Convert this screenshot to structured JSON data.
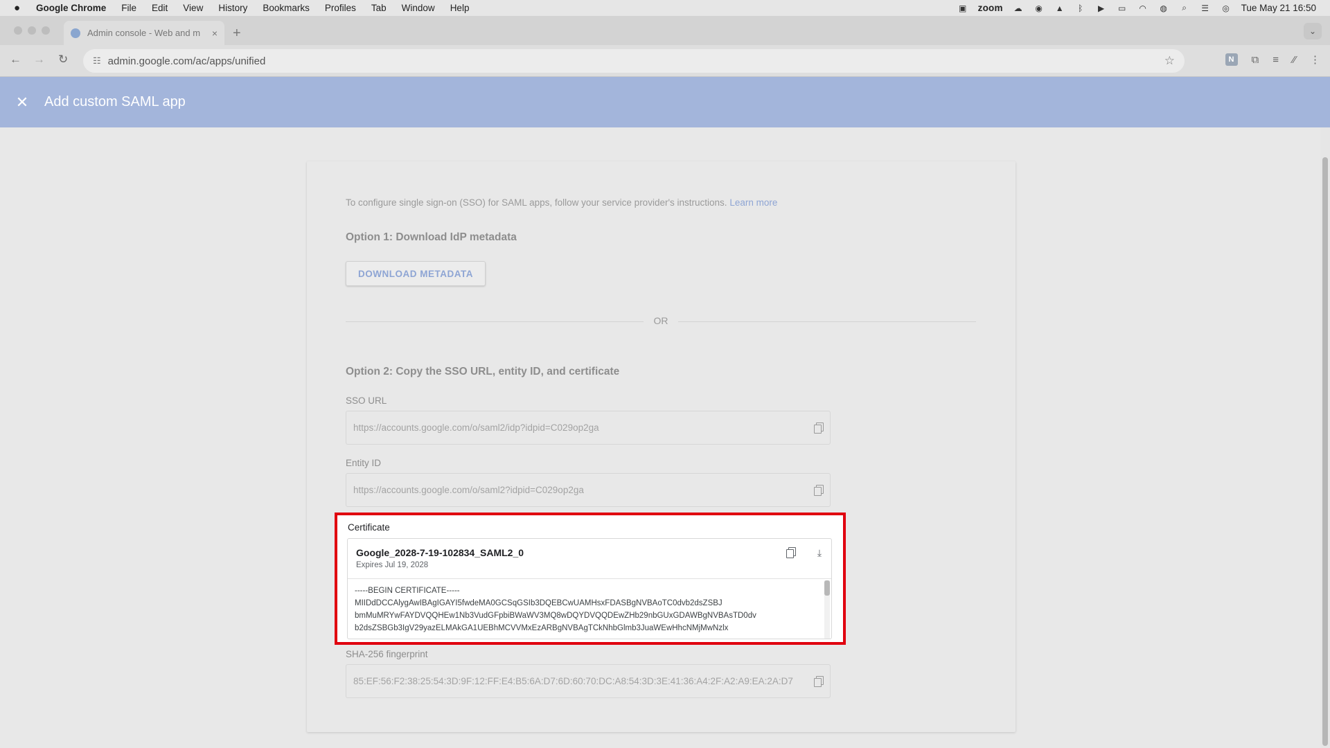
{
  "menubar": {
    "apple": "",
    "app_name": "Google Chrome",
    "items": [
      "File",
      "Edit",
      "View",
      "History",
      "Bookmarks",
      "Profiles",
      "Tab",
      "Window",
      "Help"
    ],
    "zoom": "zoom",
    "datetime": "Tue May 21  16:50"
  },
  "browser": {
    "tab_title": "Admin console - Web and m",
    "tab_close": "×",
    "new_tab": "+",
    "tab_menu": "⌄",
    "url": "admin.google.com/ac/apps/unified",
    "ext_badge": "N"
  },
  "header": {
    "close": "✕",
    "title": "Add custom SAML app"
  },
  "page": {
    "intro_text": "To configure single sign-on (SSO) for SAML apps, follow your service provider's instructions.",
    "learn_more": "Learn more",
    "option1_title": "Option 1: Download IdP metadata",
    "download_button": "DOWNLOAD METADATA",
    "or_text": "OR",
    "option2_title": "Option 2: Copy the SSO URL, entity ID, and certificate",
    "sso_url_label": "SSO URL",
    "sso_url_value": "https://accounts.google.com/o/saml2/idp?idpid=C029op2ga",
    "entity_id_label": "Entity ID",
    "entity_id_value": "https://accounts.google.com/o/saml2?idpid=C029op2ga",
    "certificate_label": "Certificate",
    "certificate_name": "Google_2028-7-19-102834_SAML2_0",
    "certificate_expires": "Expires Jul 19, 2028",
    "certificate_lines": [
      "-----BEGIN CERTIFICATE-----",
      "MIIDdDCCAlygAwIBAgIGAYI5fwdeMA0GCSqGSIb3DQEBCwUAMHsxFDASBgNVBAoTC0dvb2dsZSBJ",
      "bmMuMRYwFAYDVQQHEw1Nb3VudGFpbiBWaWV3MQ8wDQYDVQQDEwZHb29nbGUxGDAWBgNVBAsTD0dv",
      "b2dsZSBGb3IgV29yazELMAkGA1UEBhMCVVMxEzARBgNVBAgTCkNhbGlmb3JuaWEwHhcNMjMwNzlx"
    ],
    "sha_label": "SHA-256 fingerprint",
    "sha_value": "85:EF:56:F2:38:25:54:3D:9F:12:FF:E4:B5:6A:D7:6D:60:70:DC:A8:54:3D:3E:41:36:A4:2F:A2:A9:EA:2A:D7"
  },
  "colors": {
    "header_bg": "#a3b5db",
    "highlight_border": "#e0000f",
    "link": "#8ea5d4"
  }
}
